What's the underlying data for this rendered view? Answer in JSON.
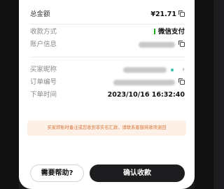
{
  "order": {
    "total_label": "总金额",
    "total_value": "¥21.71",
    "method_label": "收款方式",
    "method_value": "微信支付",
    "account_label": "账户信息",
    "buyer_label": "买家昵称",
    "order_no_label": "订单编号",
    "time_label": "下单时间",
    "time_value": "2023/10/16 16:32:40"
  },
  "notice": {
    "text": "买家转账时备注或您收到非实名汇款，请联系客服将款项退回"
  },
  "actions": {
    "help_label": "需要帮助?",
    "confirm_label": "确认收款"
  },
  "colors": {
    "accent_green": "#1aad19",
    "notice_bg": "#fdf1e7",
    "notice_text": "#d9753a",
    "confirm_bg": "#1d1d1f"
  }
}
